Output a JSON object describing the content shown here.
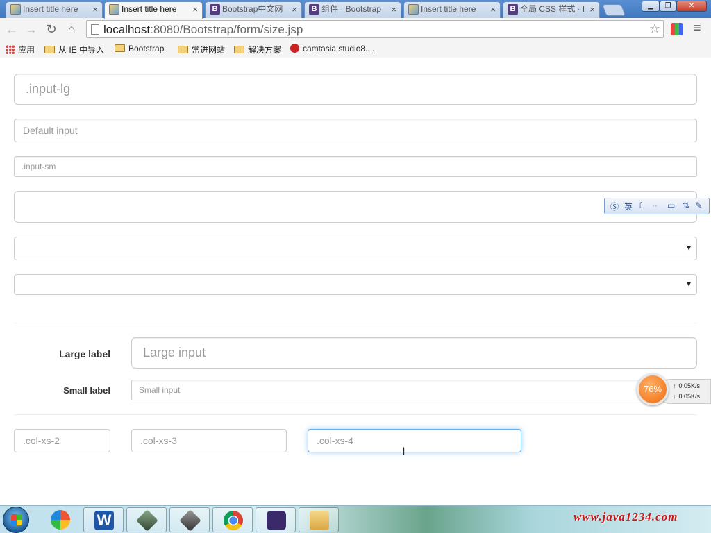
{
  "tabs": [
    {
      "title": "Insert title here",
      "favicon": "picture-icon",
      "active": false
    },
    {
      "title": "Insert title here",
      "favicon": "picture-icon",
      "active": true
    },
    {
      "title": "Bootstrap中文网",
      "favicon": "bootstrap-icon",
      "active": false
    },
    {
      "title": "组件 · Bootstrap",
      "favicon": "bootstrap-icon",
      "active": false
    },
    {
      "title": "Insert title here",
      "favicon": "picture-icon",
      "active": false
    },
    {
      "title": "全局 CSS 样式 · B",
      "favicon": "bootstrap-icon",
      "active": false
    }
  ],
  "tab_close_glyph": "×",
  "toolbar": {
    "url_host": "localhost",
    "url_path": ":8080/Bootstrap/form/size.jsp"
  },
  "bookmarks": [
    {
      "label": "应用",
      "icon": "apps-grid-icon"
    },
    {
      "label": "从 IE 中导入",
      "icon": "folder-icon"
    },
    {
      "label": "Bootstrap",
      "icon": "folder-icon"
    },
    {
      "label": "常进网站",
      "icon": "folder-icon"
    },
    {
      "label": "解决方案",
      "icon": "folder-icon"
    },
    {
      "label": "camtasia studio8....",
      "icon": "camtasia-icon"
    }
  ],
  "form": {
    "input_lg": ".input-lg",
    "input_default": "Default input",
    "input_sm": ".input-sm",
    "large_label": "Large label",
    "large_input": "Large input",
    "small_label": "Small label",
    "small_input": "Small input",
    "col_xs_2": ".col-xs-2",
    "col_xs_3": ".col-xs-3",
    "col_xs_4": ".col-xs-4"
  },
  "ime": {
    "mode": "英"
  },
  "net_widget": {
    "percent": "76%",
    "up": "0.05K/s",
    "down": "0.05K/s"
  },
  "taskbar": {
    "brand": "www.java1234.com"
  },
  "colors": {
    "focus_border": "#66afe9",
    "brand_red": "#d01515",
    "accent": "#f06a10"
  }
}
